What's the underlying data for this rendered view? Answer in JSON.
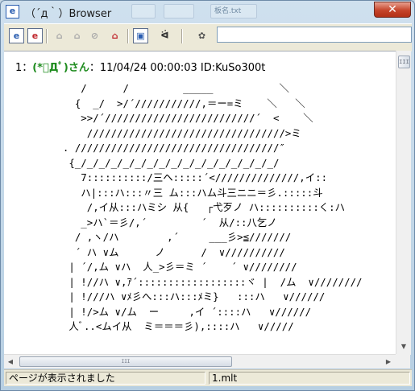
{
  "window": {
    "title": "（´д｀）Browser",
    "close_glyph": "✕",
    "app_icon_letter": "e"
  },
  "background_tabs": [
    "",
    "",
    "板名.txt"
  ],
  "toolbar": {
    "buttons": [
      {
        "name": "ie-icon-a-button",
        "glyph": "e"
      },
      {
        "name": "ie-icon-b-button",
        "glyph": "e"
      },
      {
        "name": "back-icon-button",
        "glyph": "⌂"
      },
      {
        "name": "forward-icon-button",
        "glyph": "⌂"
      },
      {
        "name": "stop-icon-button",
        "glyph": "⊘"
      },
      {
        "name": "home-icon-button",
        "glyph": "⌂"
      },
      {
        "name": "refresh-icon-button",
        "glyph": "▣"
      },
      {
        "name": "face-icon-button",
        "glyph": "ᐛ"
      },
      {
        "name": "settings-icon-button",
        "glyph": "✿"
      }
    ]
  },
  "address": {
    "value": ""
  },
  "post": {
    "number": "1",
    "sep": "：",
    "name": "(*ﾟДﾟ)さん",
    "meta": "：11/04/24 00:00:03 ID:KuSo300t"
  },
  "ascii_art": "     /      /         _____           ＼\n    {  _/  >/´///////////,＝ー=ミ    ＼   ＼\n     >>/´/////////////////////////´  <    ＼\n      /////////////////////////////////>ミ\n  . //////////////////////////////////″\n   {_/_/_/_/_/_/_/_/_/_/_/_/_/_/_/_/_/ \n     7::::::::::/三ヘ:::::´<//////////////,イ::\n     ハ|:::ハ:::〃三 ム:::ハム斗三ニニ＝彡.:::::斗\n      /,イ从:::ハミシ 从{   ┌弋歹ノ ハ::::::::::く:ハ\n     _>ハ`＝彡/,´         ´  从/::八乞ノ\n    / ,ヽ/ハ        ,´     ___彡>≦///////\n    ´ ハ ∨ム      ノ      /  ∨//////////\n   | ´/,ム ∨ハ  人_>彡＝ミ ´    ´ ∨////////\n   | !//ハ ∨,ｱ´::::::::::::::::::ヾ |  /ム  ∨////////\n   | !///ハ ∨ﾒ彡へ:::ハ:::ﾒミ}   :::ハ   ∨//////\n   | !/>ム ∨/ム  ー     ,イ ´::::ハ   ∨//////\n   人ﾞ..<ムイ从  ミ＝＝＝彡),::::ハ   ∨/////",
  "scrollbar": {
    "grip": "III"
  },
  "status": {
    "message": "ページが表示されました",
    "file": "1.mlt"
  }
}
